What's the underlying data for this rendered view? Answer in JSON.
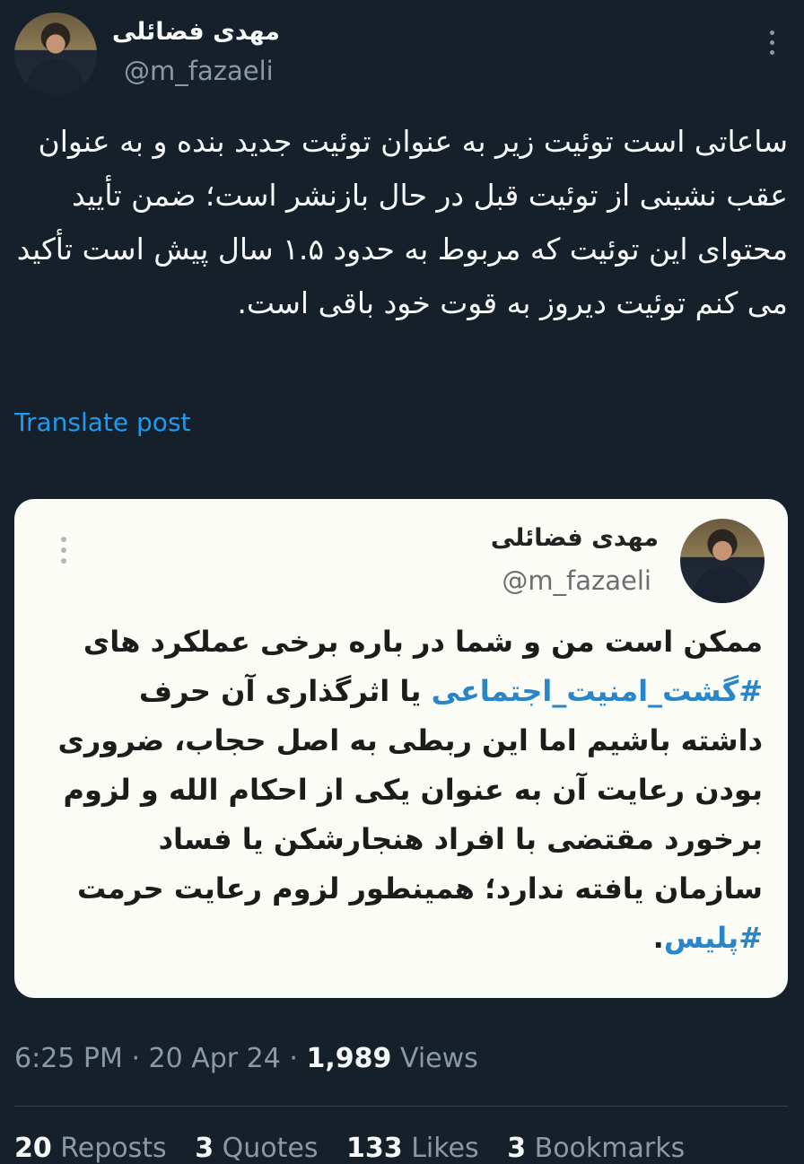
{
  "post": {
    "author_name": "مهدی فضائلی",
    "author_handle": "@m_fazaeli",
    "text": "ساعاتی است توئیت زیر به عنوان توئیت جدید بنده و به عنوان عقب نشینی از توئیت قبل در حال بازنشر است؛ ضمن تأیید محتوای این توئیت که مربوط به حدود ۱.۵ سال پیش است تأکید می کنم توئیت دیروز به قوت خود باقی است.",
    "translate_label": "Translate post"
  },
  "quoted": {
    "author_name": "مهدی فضائلی",
    "author_handle": "@m_fazaeli",
    "text_part1": "ممکن است من و شما در باره برخی عملکرد های ",
    "hashtag1": "#گشت_امنیت_اجتماعی",
    "text_part2": " یا اثرگذاری آن حرف داشته باشیم اما این ربطی به اصل حجاب، ضروری بودن رعایت آن به عنوان یکی از احکام الله و لزوم برخورد مقتضی با افراد هنجارشکن یا فساد سازمان یافته ندارد؛ همینطور لزوم رعایت حرمت ",
    "hashtag2": "#پلیس",
    "text_part3": "."
  },
  "meta": {
    "time": "6:25 PM",
    "separator": "·",
    "date": "20 Apr 24",
    "views_count": "1,989",
    "views_label": "Views"
  },
  "stats": {
    "reposts_count": "20",
    "reposts_label": "Reposts",
    "quotes_count": "3",
    "quotes_label": "Quotes",
    "likes_count": "133",
    "likes_label": "Likes",
    "bookmarks_count": "3",
    "bookmarks_label": "Bookmarks"
  },
  "colors": {
    "background": "#15202b",
    "link": "#1d9bf0",
    "secondary_text": "#8b98a5",
    "card_background": "#fbfcf6",
    "hashtag": "#2a86c8"
  }
}
